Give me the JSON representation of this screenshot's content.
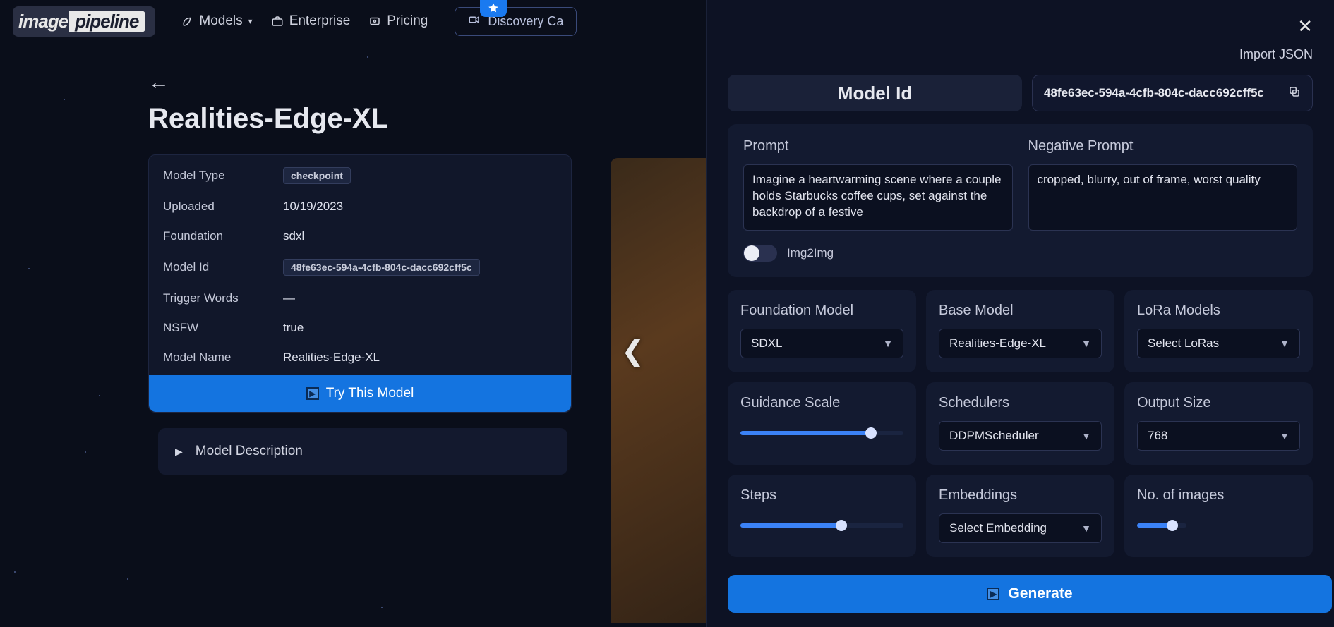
{
  "header": {
    "logo1": "image",
    "logo2": "pipeline",
    "nav": {
      "models": "Models",
      "enterprise": "Enterprise",
      "pricing": "Pricing",
      "discovery": "Discovery Ca"
    }
  },
  "page": {
    "title": "Realities-Edge-XL",
    "info": {
      "model_type_label": "Model Type",
      "model_type_value": "checkpoint",
      "uploaded_label": "Uploaded",
      "uploaded_value": "10/19/2023",
      "foundation_label": "Foundation",
      "foundation_value": "sdxl",
      "model_id_label": "Model Id",
      "model_id_value": "48fe63ec-594a-4cfb-804c-dacc692cff5c",
      "trigger_label": "Trigger Words",
      "trigger_value": "—",
      "nsfw_label": "NSFW",
      "nsfw_value": "true",
      "model_name_label": "Model Name",
      "model_name_value": "Realities-Edge-XL"
    },
    "try_button": "Try This Model",
    "desc_title": "Model Description"
  },
  "panel": {
    "import_json": "Import JSON",
    "model_id_label": "Model Id",
    "model_id_value": "48fe63ec-594a-4cfb-804c-dacc692cff5c",
    "prompt_label": "Prompt",
    "prompt_value": "Imagine a heartwarming scene where a couple holds Starbucks coffee cups, set against the backdrop of a festive",
    "neg_label": "Negative Prompt",
    "neg_value": "cropped, blurry, out of frame, worst quality",
    "img2img_label": "Img2Img",
    "foundation_label": "Foundation Model",
    "foundation_value": "SDXL",
    "base_label": "Base Model",
    "base_value": "Realities-Edge-XL",
    "lora_label": "LoRa Models",
    "lora_value": "Select LoRas",
    "guidance_label": "Guidance Scale",
    "scheduler_label": "Schedulers",
    "scheduler_value": "DDPMScheduler",
    "output_label": "Output Size",
    "output_value": "768",
    "steps_label": "Steps",
    "embed_label": "Embeddings",
    "embed_value": "Select Embedding",
    "num_images_label": "No. of images",
    "generate": "Generate"
  }
}
